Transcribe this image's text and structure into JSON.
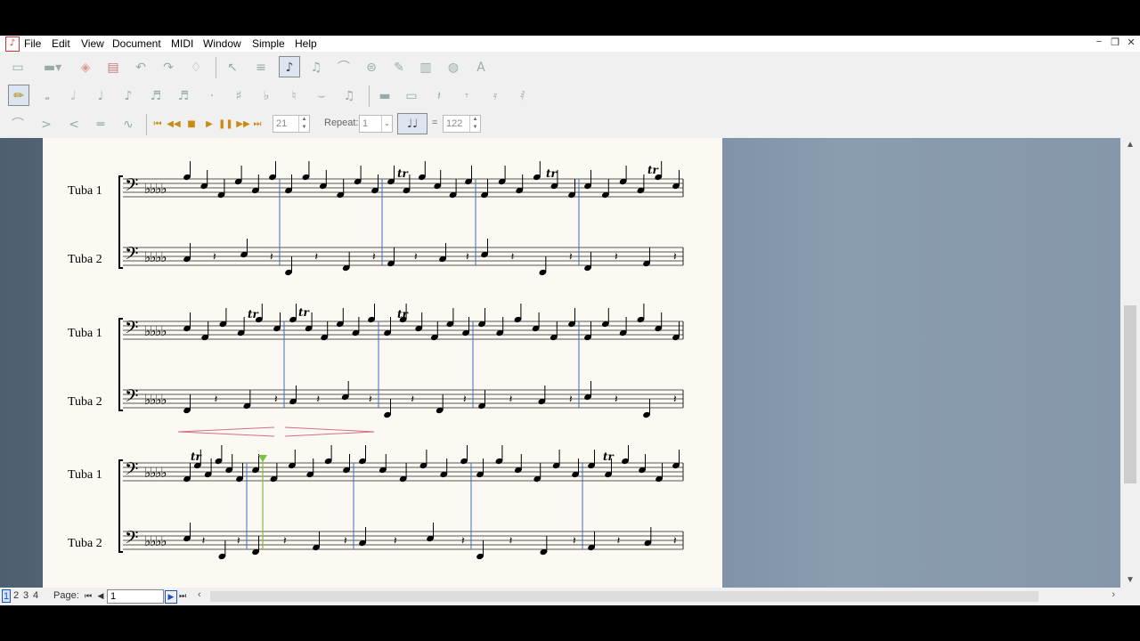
{
  "menu": {
    "items": [
      "File",
      "Edit",
      "View",
      "Document",
      "MIDI",
      "Window",
      "Simple",
      "Help"
    ]
  },
  "window_controls": {
    "minimize": "−",
    "restore": "❐",
    "close": "✕"
  },
  "toolbar": {
    "repeat_label": "Repeat:",
    "measure_value": "21",
    "repeat_value": "1",
    "tempo_value": "122",
    "tempo_equals": "="
  },
  "score": {
    "instruments": [
      "Tuba 1",
      "Tuba 2",
      "Tuba 1",
      "Tuba 2",
      "Tuba 1",
      "Tuba 2"
    ],
    "ornament": "tr",
    "accent_color": "#3a6fc4",
    "hairpin_color": "#d07080",
    "cursor_color": "#7ac043"
  },
  "status": {
    "page_tabs": [
      "1",
      "2",
      "3",
      "4"
    ],
    "active_tab": "1",
    "page_label": "Page:",
    "page_value": "1"
  },
  "icons": [
    "new-icon",
    "open-icon",
    "eraser-icon",
    "print-icon",
    "undo-icon",
    "redo-icon",
    "play-icon",
    "stop-icon",
    "pause-icon",
    "text-icon"
  ]
}
